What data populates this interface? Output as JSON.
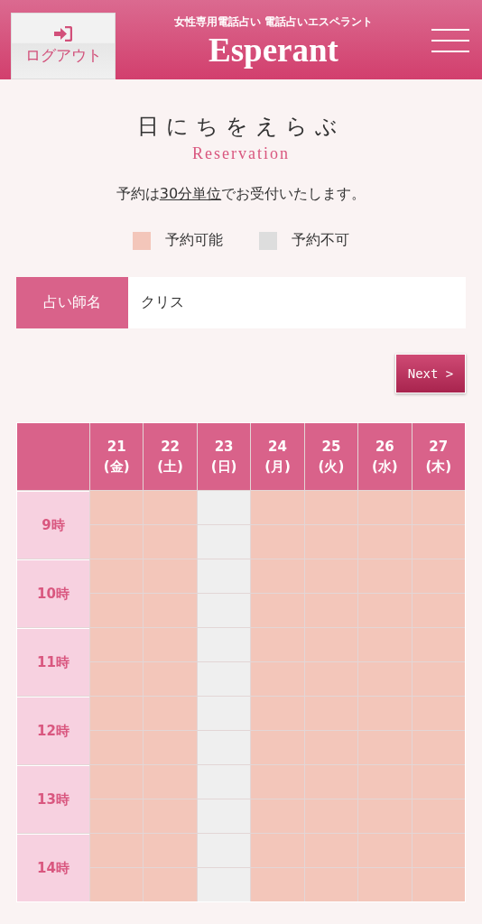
{
  "header": {
    "logout": "ログアウト",
    "tagline": "女性専用電話占い 電話占いエスペラント",
    "logo": "Esperant"
  },
  "heading": {
    "title": "日にちをえらぶ",
    "subtitle": "Reservation"
  },
  "notice": {
    "before": "予約は",
    "underlined": "30分単位",
    "after": "でお受付いたします。"
  },
  "legend": [
    {
      "label": "予約可能",
      "color": "#f3c6ba"
    },
    {
      "label": "予約不可",
      "color": "#dddddd"
    }
  ],
  "fortune_teller": {
    "label": "占い師名",
    "value": "クリス"
  },
  "next_button": "Next >",
  "table": {
    "days": [
      {
        "date": "21",
        "weekday": "(金)"
      },
      {
        "date": "22",
        "weekday": "(土)"
      },
      {
        "date": "23",
        "weekday": "(日)"
      },
      {
        "date": "24",
        "weekday": "(月)"
      },
      {
        "date": "25",
        "weekday": "(火)"
      },
      {
        "date": "26",
        "weekday": "(水)"
      },
      {
        "date": "27",
        "weekday": "(木)"
      }
    ],
    "hours": [
      {
        "label": "9時",
        "slots": [
          [
            true,
            true,
            false,
            true,
            true,
            true,
            true
          ],
          [
            true,
            true,
            false,
            true,
            true,
            true,
            true
          ]
        ]
      },
      {
        "label": "10時",
        "slots": [
          [
            true,
            true,
            false,
            true,
            true,
            true,
            true
          ],
          [
            true,
            true,
            false,
            true,
            true,
            true,
            true
          ]
        ]
      },
      {
        "label": "11時",
        "slots": [
          [
            true,
            true,
            false,
            true,
            true,
            true,
            true
          ],
          [
            true,
            true,
            false,
            true,
            true,
            true,
            true
          ]
        ]
      },
      {
        "label": "12時",
        "slots": [
          [
            true,
            true,
            false,
            true,
            true,
            true,
            true
          ],
          [
            true,
            true,
            false,
            true,
            true,
            true,
            true
          ]
        ]
      },
      {
        "label": "13時",
        "slots": [
          [
            true,
            true,
            false,
            true,
            true,
            true,
            true
          ],
          [
            true,
            true,
            false,
            true,
            true,
            true,
            true
          ]
        ]
      },
      {
        "label": "14時",
        "slots": [
          [
            true,
            true,
            false,
            true,
            true,
            true,
            true
          ],
          [
            true,
            true,
            false,
            true,
            true,
            true,
            true
          ]
        ]
      }
    ]
  }
}
